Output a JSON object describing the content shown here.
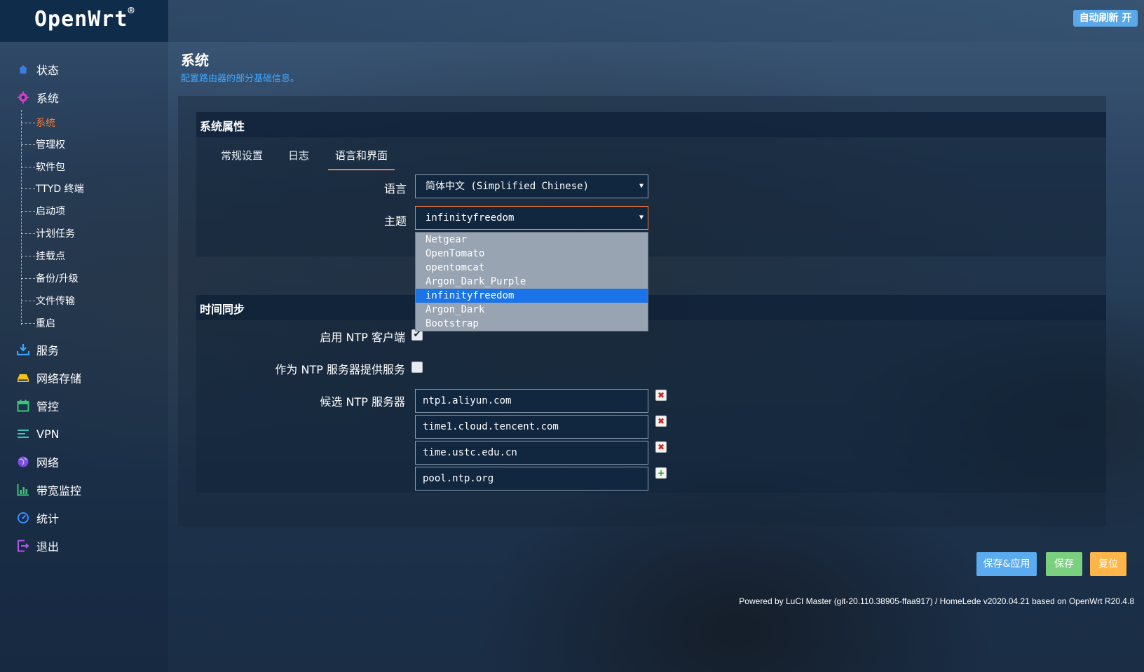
{
  "app": {
    "logo": "OpenWrt",
    "logo_mark": "®",
    "auto_refresh_label": "自动刷新 开"
  },
  "sidebar": {
    "items": [
      {
        "label": "状态",
        "icon": "home-icon"
      },
      {
        "label": "系统",
        "icon": "gear-icon"
      },
      {
        "label": "服务",
        "icon": "download-tray-icon"
      },
      {
        "label": "网络存储",
        "icon": "storage-icon"
      },
      {
        "label": "管控",
        "icon": "calendar-icon"
      },
      {
        "label": "VPN",
        "icon": "lines-icon"
      },
      {
        "label": "网络",
        "icon": "globe-icon"
      },
      {
        "label": "带宽监控",
        "icon": "bar-chart-icon"
      },
      {
        "label": "统计",
        "icon": "gauge-icon"
      },
      {
        "label": "退出",
        "icon": "logout-icon"
      }
    ],
    "system_submenu": [
      {
        "label": "系统",
        "active": true
      },
      {
        "label": "管理权"
      },
      {
        "label": "软件包"
      },
      {
        "label": "TTYD 终端"
      },
      {
        "label": "启动项"
      },
      {
        "label": "计划任务"
      },
      {
        "label": "挂载点"
      },
      {
        "label": "备份/升级"
      },
      {
        "label": "文件传输"
      },
      {
        "label": "重启"
      }
    ]
  },
  "main": {
    "title": "系统",
    "description": "配置路由器的部分基础信息。",
    "system_properties": {
      "title": "系统属性",
      "tabs": [
        {
          "label": "常规设置"
        },
        {
          "label": "日志"
        },
        {
          "label": "语言和界面",
          "active": true
        }
      ],
      "language": {
        "label": "语言",
        "value": "简体中文 (Simplified Chinese)"
      },
      "theme": {
        "label": "主题",
        "value": "infinityfreedom",
        "options": [
          "Netgear",
          "OpenTomato",
          "opentomcat",
          "Argon_Dark_Purple",
          "infinityfreedom",
          "Argon_Dark",
          "Bootstrap"
        ],
        "selected_index": 4
      }
    },
    "time_sync": {
      "title": "时间同步",
      "enable_ntp_client": {
        "label": "启用 NTP 客户端",
        "checked": true,
        "mark": "✔"
      },
      "ntp_server": {
        "label": "作为 NTP 服务器提供服务",
        "checked": false,
        "mark": ""
      },
      "candidate_servers": {
        "label": "候选 NTP 服务器",
        "values": [
          "ntp1.aliyun.com",
          "time1.cloud.tencent.com",
          "time.ustc.edu.cn",
          "pool.ntp.org"
        ]
      }
    }
  },
  "actions": {
    "save_apply": "保存&应用",
    "save": "保存",
    "reset": "复位"
  },
  "footer": "Powered by LuCI Master (git-20.110.38905-ffaa917) / HomeLede v2020.04.21 based on OpenWrt R20.4.8",
  "colors": {
    "accent": "#ff7a2f",
    "link": "#3fa6ff",
    "save_apply": "#5aabef",
    "save": "#7bd07f",
    "reset": "#ffb547",
    "logo_bg": "#0f2d4b"
  }
}
